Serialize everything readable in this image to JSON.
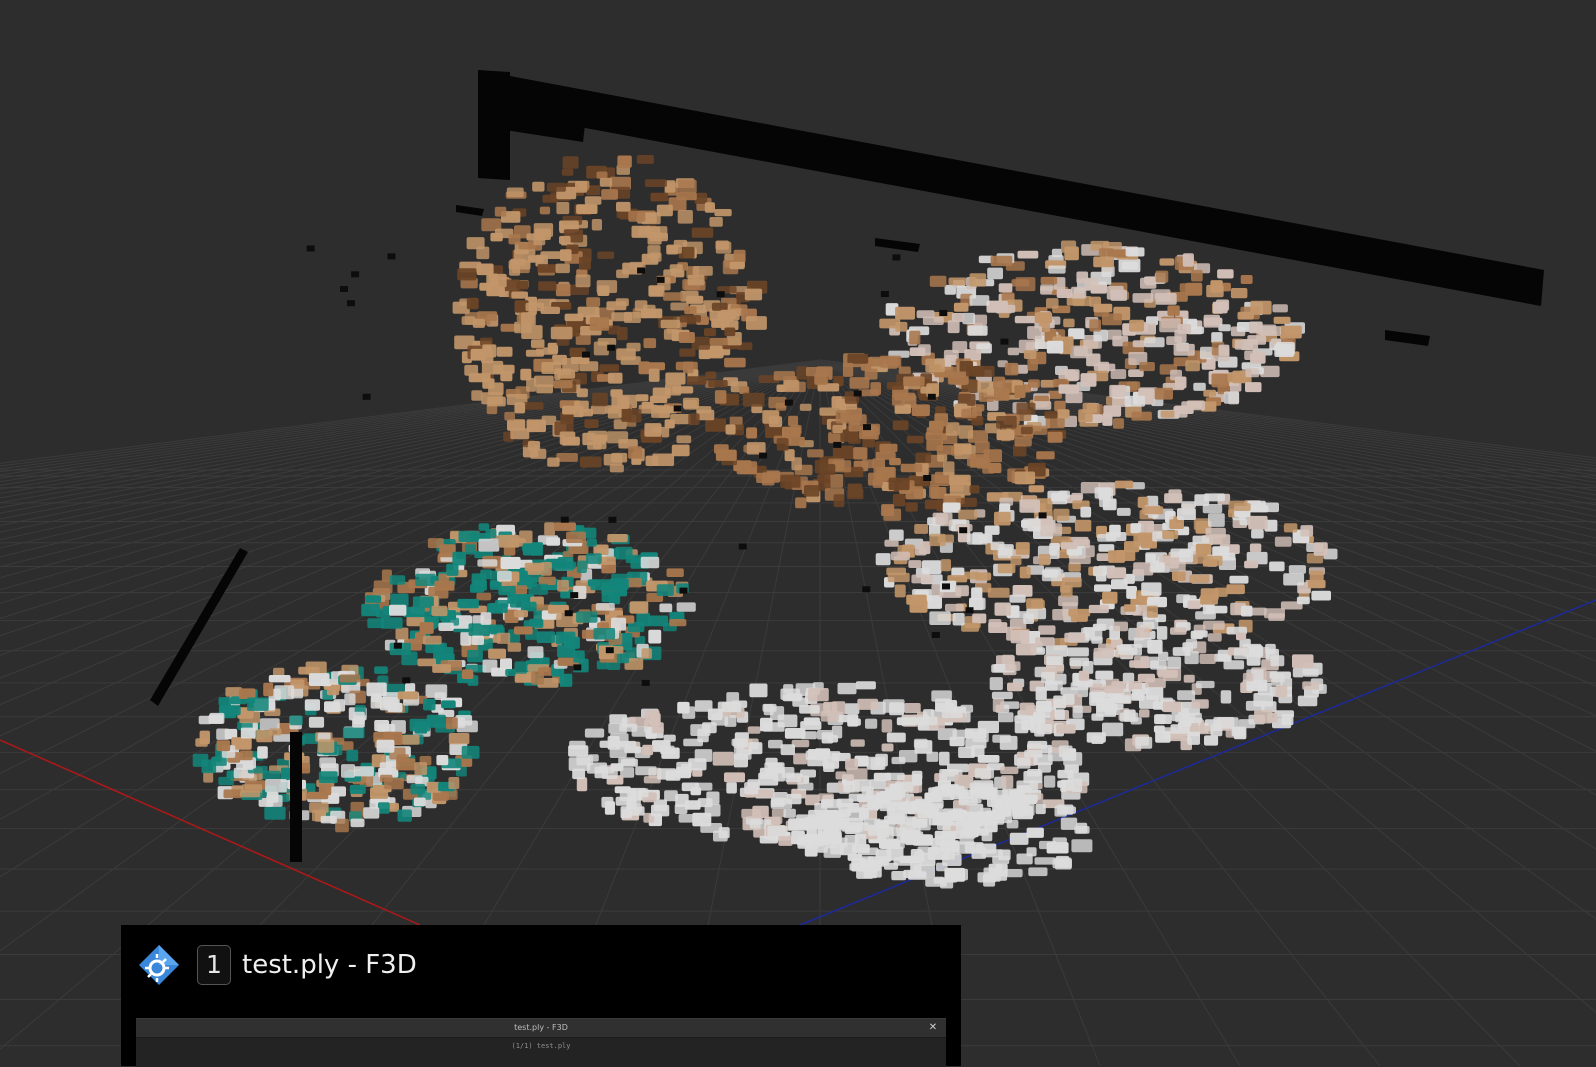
{
  "viewer": {
    "background_color": "#2d2d2d",
    "grid_color": "#3b3b3b",
    "x_axis_color": "#b01818",
    "z_axis_color": "#1c2a9a",
    "point_palette": [
      "#c2966a",
      "#a9774d",
      "#6b4426",
      "#dcdcdc",
      "#d2c0b8",
      "#13857a",
      "#0d0d0d"
    ]
  },
  "taskbar_preview": {
    "app_icon": "f3d-app-icon",
    "window_number": "1",
    "window_title": "test.ply - F3D",
    "thumbnail": {
      "title": "test.ply - F3D",
      "close_icon": "close-icon",
      "close_glyph": "✕",
      "status": "(1/1) test.ply"
    }
  }
}
